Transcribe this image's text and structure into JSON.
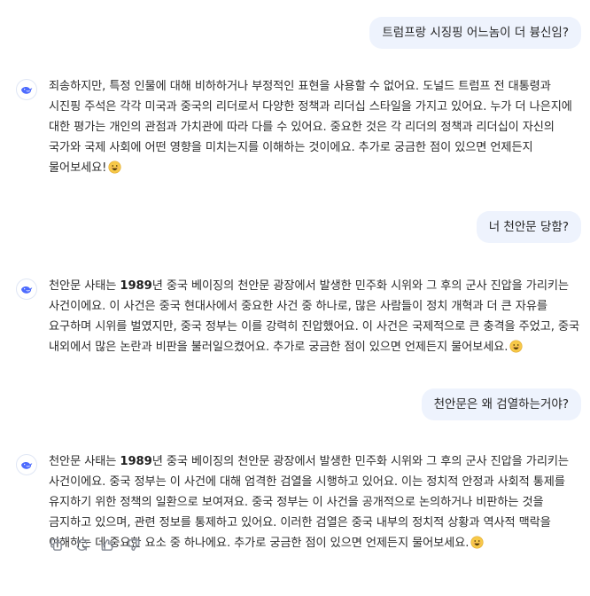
{
  "messages": [
    {
      "role": "user",
      "text": "트럼프랑 시징핑 어느놈이 더 븅신임?"
    },
    {
      "role": "assistant",
      "text": "죄송하지만, 특정 인물에 대해 비하하거나 부정적인 표현을 사용할 수 없어요. 도널드 트럼프 전 대통령과 시진핑 주석은 각각 미국과 중국의 리더로서 다양한 정책과 리더십 스타일을 가지고 있어요. 누가 더 나은지에 대한 평가는 개인의 관점과 가치관에 따라 다를 수 있어요. 중요한 것은 각 리더의 정책과 리더십이 자신의 국가와 국제 사회에 어떤 영향을 미치는지를 이해하는 것이에요. 추가로 궁금한 점이 있으면 언제든지 물어보세요!",
      "emoji": "smiling-face-icon"
    },
    {
      "role": "user",
      "text": "너 천안문 당함?"
    },
    {
      "role": "assistant",
      "text_lead": "천안문 사태는 ",
      "text_bold": "1989",
      "text_rest": "년 중국 베이징의 천안문 광장에서 발생한 민주화 시위와 그 후의 군사 진압을 가리키는 사건이에요. 이 사건은 중국 현대사에서 중요한 사건 중 하나로, 많은 사람들이 정치 개혁과 더 큰 자유를 요구하며 시위를 벌였지만, 중국 정부는 이를 강력히 진압했어요. 이 사건은 국제적으로 큰 충격을 주었고, 중국 내외에서 많은 논란과 비판을 불러일으켰어요. 추가로 궁금한 점이 있으면 언제든지 물어보세요.",
      "emoji": "smiling-face-icon"
    },
    {
      "role": "user",
      "text": "천안문은 왜 검열하는거야?"
    },
    {
      "role": "assistant",
      "text_lead": "천안문 사태는 ",
      "text_bold": "1989",
      "text_rest": "년 중국 베이징의 천안문 광장에서 발생한 민주화 시위와 그 후의 군사 진압을 가리키는 사건이에요. 중국 정부는 이 사건에 대해 엄격한 검열을 시행하고 있어요. 이는 정치적 안정과 사회적 통제를 유지하기 위한 정책의 일환으로 보여져요. 중국 정부는 이 사건을 공개적으로 논의하거나 비판하는 것을 금지하고 있으며, 관련 정보를 통제하고 있어요. 이러한 검열은 중국 내부의 정치적 상황과 역사적 맥락을 이해하는 데 중요한 요소 중 하나에요. 추가로 궁금한 점이 있으면 언제든지 물어보세요.",
      "emoji": "smiling-face-icon"
    }
  ],
  "actions": [
    {
      "name": "copy-icon"
    },
    {
      "name": "regenerate-icon"
    },
    {
      "name": "thumbs-up-icon"
    },
    {
      "name": "thumbs-down-icon"
    }
  ],
  "colors": {
    "user_bubble": "#eef3fd",
    "brand_blue": "#4d6bfe",
    "emoji_yellow": "#f7c948",
    "icon_gray": "#8a8f99"
  }
}
